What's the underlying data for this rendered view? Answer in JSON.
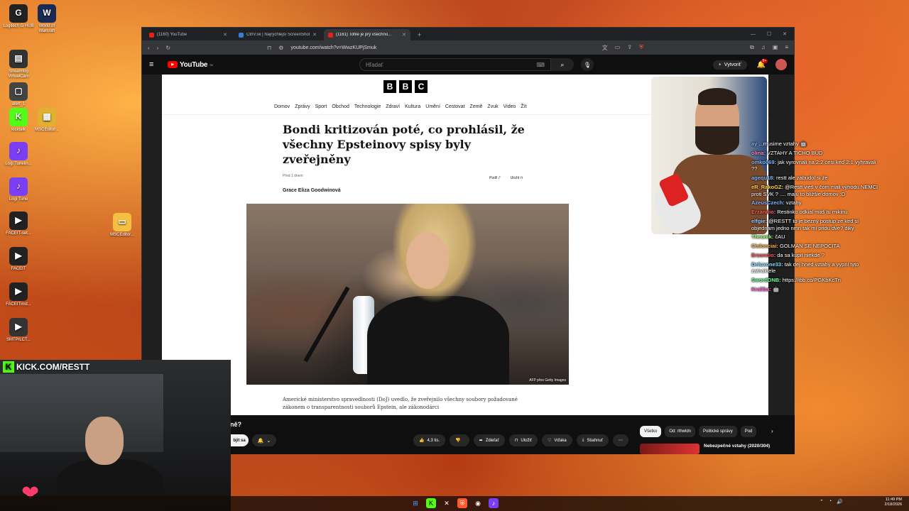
{
  "desktop": {
    "icons": [
      {
        "label": "Logitech G HUB",
        "icon": "logitech-icon",
        "color": "#222222",
        "glyph": "G"
      },
      {
        "label": "World of Warcraft",
        "icon": "wow-icon",
        "color": "#1a2a55",
        "glyph": "W"
      },
      {
        "label": "Streamfog VirtualCam",
        "icon": "streamfog-icon",
        "color": "#333333",
        "glyph": "▤"
      },
      {
        "label": "alert_1",
        "icon": "file-icon",
        "color": "#444444",
        "glyph": "▢"
      },
      {
        "label": "kicktalk",
        "icon": "kick-icon",
        "color": "#53fc18",
        "glyph": "K"
      },
      {
        "label": "MSCEditor...",
        "icon": "msc-icon",
        "color": "#e0b030",
        "glyph": "▦"
      },
      {
        "label": "Logi Tunelin...",
        "icon": "logi-tune-icon",
        "color": "#7a3ff2",
        "glyph": "♪"
      },
      {
        "label": "Logi Tune",
        "icon": "logi-tune-icon",
        "color": "#7a3ff2",
        "glyph": "♪"
      },
      {
        "label": "FACEIT-set...",
        "icon": "faceit-icon",
        "color": "#222222",
        "glyph": "▶"
      },
      {
        "label": "FACEIT",
        "icon": "faceit-icon",
        "color": "#222222",
        "glyph": "▶"
      },
      {
        "label": "FACEITInst...",
        "icon": "faceit-icon",
        "color": "#222222",
        "glyph": "▶"
      },
      {
        "label": "SMTP/LCT...",
        "icon": "app-icon",
        "color": "#333333",
        "glyph": "▶"
      },
      {
        "label": "MSCEditor...",
        "icon": "folder-icon",
        "color": "#f5c042",
        "glyph": "▭"
      }
    ]
  },
  "browser": {
    "tabs": [
      {
        "title": "(1160) YouTube",
        "active": false
      },
      {
        "title": "CtrlV.sk | Najrýchlejší ScreenShot a P...",
        "active": false
      },
      {
        "title": "(1161) Tohle je prý všechno...",
        "active": true
      }
    ],
    "url": "youtube.com/watch?v=WwzKUPjSmuk"
  },
  "youtube": {
    "logo": "YouTube",
    "region": "SK",
    "search_placeholder": "Hľadať",
    "create_label": "Vytvoriť",
    "notif_badge": "9+",
    "video_title": "ně?",
    "subscribe_label": "bjit sa",
    "actions": [
      {
        "icon": "like-icon",
        "label": "4,3 tis."
      },
      {
        "icon": "dislike-icon",
        "label": ""
      },
      {
        "icon": "share-icon",
        "label": "Zdieľať"
      },
      {
        "icon": "save-icon",
        "label": "Uložiť"
      },
      {
        "icon": "thanks-icon",
        "label": "Vďaka"
      },
      {
        "icon": "download-icon",
        "label": "Stiahnuť"
      },
      {
        "icon": "more-icon",
        "label": "⋯"
      }
    ],
    "chips": [
      {
        "label": "Všetko",
        "active": true
      },
      {
        "label": "Od: rthwldn",
        "active": false
      },
      {
        "label": "Politické správy",
        "active": false
      },
      {
        "label": "Pod",
        "active": false
      }
    ],
    "recommendation": {
      "title": "Nebezpečné vztahy (2020/304)"
    }
  },
  "bbc": {
    "logo": [
      "B",
      "B",
      "C"
    ],
    "nav": [
      "Domov",
      "Zprávy",
      "Sport",
      "Obchod",
      "Technologie",
      "Zdraví",
      "Kultura",
      "Umění",
      "Cestovat",
      "Země",
      "Zvuk",
      "Video",
      "Žít"
    ],
    "headline": "Bondi kritizován poté, co prohlásil, že všechny Epsteinovy spisy byly zveřejněny",
    "time": "Před 1 dnem",
    "share": "Podíl",
    "save": "Uložit",
    "author": "Grace Eliza Goodwinová",
    "photo_credit": "AFP přes Getty Images",
    "body": "Americké ministerstvo spravedlnosti (DoJ) uvedlo, že zveřejnilo všechny soubory požadované zákonem o transparentnosti souborů Epstein, ale zákonodárci"
  },
  "chat": [
    {
      "user": "ay",
      "color": "#7fb8ff",
      "text": "...musime vztahy 🤖"
    },
    {
      "user": "olina:",
      "color": "#ff8ab8",
      "text": "VZTAHY A TICHO BUD"
    },
    {
      "user": "omko069:",
      "color": "#7fb8ff",
      "text": "jak vyrovnali na 2:2 ćesi keď 2:1 vyhravali ??"
    },
    {
      "user": "agequ18:",
      "color": "#7fb8ff",
      "text": "restt ale zabudol si že"
    },
    {
      "user": "eR_RakoGZ:",
      "color": "#ffd54a",
      "text": "@Restt vieš v čom mali výhodu NEMCI proti SVK ? .... majú to bližšie domov :D"
    },
    {
      "user": "AzeusCzech:",
      "color": "#8ab4ff",
      "text": "vztahy"
    },
    {
      "user": "Erzandio:",
      "color": "#ff5a5a",
      "text": "Restinko odkial maš tu mikinu"
    },
    {
      "user": "elfgie:",
      "color": "#9ad0ff",
      "text": "@RESTT to je bezný postup ze ked si objednam jedno nmn tak mi pridu dve? diky"
    },
    {
      "user": "Theonik:",
      "color": "#a6ff7a",
      "text": "čAU"
    },
    {
      "user": "Cislonciai:",
      "color": "#ffb347",
      "text": "GOLMAN SE NEPOCITA"
    },
    {
      "user": "Erzandio:",
      "color": "#ff5a5a",
      "text": "da sa kupit niekde ?"
    },
    {
      "user": "Deluxone33:",
      "color": "#7fe0ff",
      "text": "tak dej hned vztahy a vypni tyto zatnaktele"
    },
    {
      "user": "SwordDNB:",
      "color": "#6fff9a",
      "text": "https://ibb.co/PGKbKcTn"
    },
    {
      "user": "Kraliba:",
      "color": "#ff6ad5",
      "text": "🤖"
    }
  ],
  "overlay": {
    "kick": "KICK.COM/RESTT"
  },
  "taskbar": {
    "time": "11:49 PM",
    "date": "2/18/2026"
  }
}
